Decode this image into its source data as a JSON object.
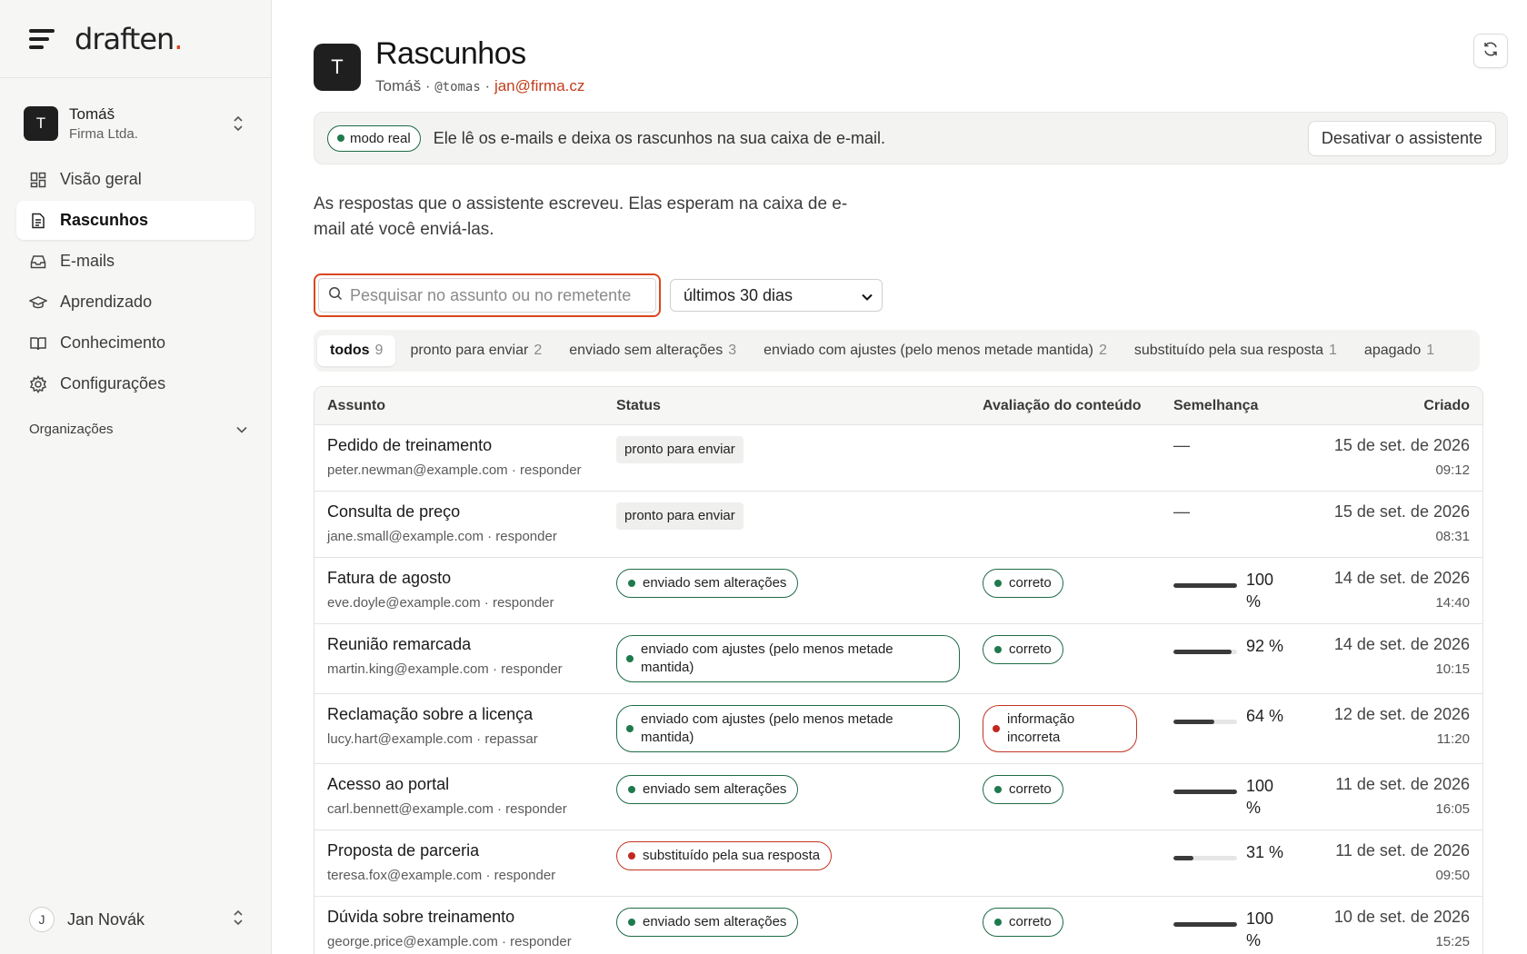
{
  "brand": {
    "name": "draften",
    "dot": "."
  },
  "account": {
    "initial": "T",
    "name": "Tomáš",
    "org": "Firma Ltda."
  },
  "nav": [
    {
      "label": "Visão geral",
      "icon": "dashboard-icon",
      "active": false
    },
    {
      "label": "Rascunhos",
      "icon": "document-icon",
      "active": true
    },
    {
      "label": "E-mails",
      "icon": "inbox-icon",
      "active": false
    },
    {
      "label": "Aprendizado",
      "icon": "graduation-cap-icon",
      "active": false
    },
    {
      "label": "Conhecimento",
      "icon": "book-icon",
      "active": false
    },
    {
      "label": "Configurações",
      "icon": "gear-icon",
      "active": false
    }
  ],
  "orgs_label": "Organizações",
  "user": {
    "initial": "J",
    "name": "Jan Novák"
  },
  "header": {
    "initial": "T",
    "title": "Rascunhos",
    "name": "Tomáš",
    "sep": "·",
    "handle": "@tomas",
    "email": "jan@firma.cz"
  },
  "banner": {
    "mode": "modo real",
    "text": "Ele lê os e-mails e deixa os rascunhos na sua caixa de e-mail.",
    "button": "Desativar o assistente"
  },
  "intro": "As respostas que o assistente escreveu. Elas esperam na caixa de e-mail até você enviá-las.",
  "search": {
    "placeholder": "Pesquisar no assunto ou no remetente",
    "value": ""
  },
  "period": {
    "selected": "últimos 30 dias"
  },
  "tabs": [
    {
      "label": "todos",
      "count": "9",
      "active": true
    },
    {
      "label": "pronto para enviar",
      "count": "2",
      "active": false
    },
    {
      "label": "enviado sem alterações",
      "count": "3",
      "active": false
    },
    {
      "label": "enviado com ajustes (pelo menos metade mantida)",
      "count": "2",
      "active": false
    },
    {
      "label": "substituído pela sua resposta",
      "count": "1",
      "active": false
    },
    {
      "label": "apagado",
      "count": "1",
      "active": false
    }
  ],
  "columns": {
    "subject": "Assunto",
    "status": "Status",
    "eval": "Avaliação do conteúdo",
    "similarity": "Semelhança",
    "created": "Criado"
  },
  "rows": [
    {
      "subject": "Pedido de treinamento",
      "from": "peter.newman@example.com · responder",
      "status": "pronto para enviar",
      "status_kind": "ready",
      "eval": "",
      "eval_kind": "",
      "similarity": "—",
      "sim_value": null,
      "date": "15 de set. de 2026",
      "time": "09:12"
    },
    {
      "subject": "Consulta de preço",
      "from": "jane.small@example.com · responder",
      "status": "pronto para enviar",
      "status_kind": "ready",
      "eval": "",
      "eval_kind": "",
      "similarity": "—",
      "sim_value": null,
      "date": "15 de set. de 2026",
      "time": "08:31"
    },
    {
      "subject": "Fatura de agosto",
      "from": "eve.doyle@example.com · responder",
      "status": "enviado sem alterações",
      "status_kind": "green",
      "eval": "correto",
      "eval_kind": "green",
      "similarity": "100 %",
      "sim_value": 100,
      "date": "14 de set. de 2026",
      "time": "14:40"
    },
    {
      "subject": "Reunião remarcada",
      "from": "martin.king@example.com · responder",
      "status": "enviado com ajustes (pelo menos metade mantida)",
      "status_kind": "green-wrap",
      "eval": "correto",
      "eval_kind": "green",
      "similarity": "92 %",
      "sim_value": 92,
      "date": "14 de set. de 2026",
      "time": "10:15"
    },
    {
      "subject": "Reclamação sobre a licença",
      "from": "lucy.hart@example.com · repassar",
      "status": "enviado com ajustes (pelo menos metade mantida)",
      "status_kind": "green-wrap",
      "eval": "informação incorreta",
      "eval_kind": "red-wrap",
      "similarity": "64 %",
      "sim_value": 64,
      "date": "12 de set. de 2026",
      "time": "11:20"
    },
    {
      "subject": "Acesso ao portal",
      "from": "carl.bennett@example.com · responder",
      "status": "enviado sem alterações",
      "status_kind": "green",
      "eval": "correto",
      "eval_kind": "green",
      "similarity": "100 %",
      "sim_value": 100,
      "date": "11 de set. de 2026",
      "time": "16:05"
    },
    {
      "subject": "Proposta de parceria",
      "from": "teresa.fox@example.com · responder",
      "status": "substituído pela sua resposta",
      "status_kind": "red",
      "eval": "",
      "eval_kind": "",
      "similarity": "31 %",
      "sim_value": 31,
      "date": "11 de set. de 2026",
      "time": "09:50"
    },
    {
      "subject": "Dúvida sobre treinamento",
      "from": "george.price@example.com · responder",
      "status": "enviado sem alterações",
      "status_kind": "green",
      "eval": "correto",
      "eval_kind": "green",
      "similarity": "100 %",
      "sim_value": 100,
      "date": "10 de set. de 2026",
      "time": "15:25"
    }
  ],
  "colors": {
    "accent": "#d9431b",
    "green": "#1e7a4c",
    "red": "#c0281f",
    "dark": "#1f1f1f"
  }
}
